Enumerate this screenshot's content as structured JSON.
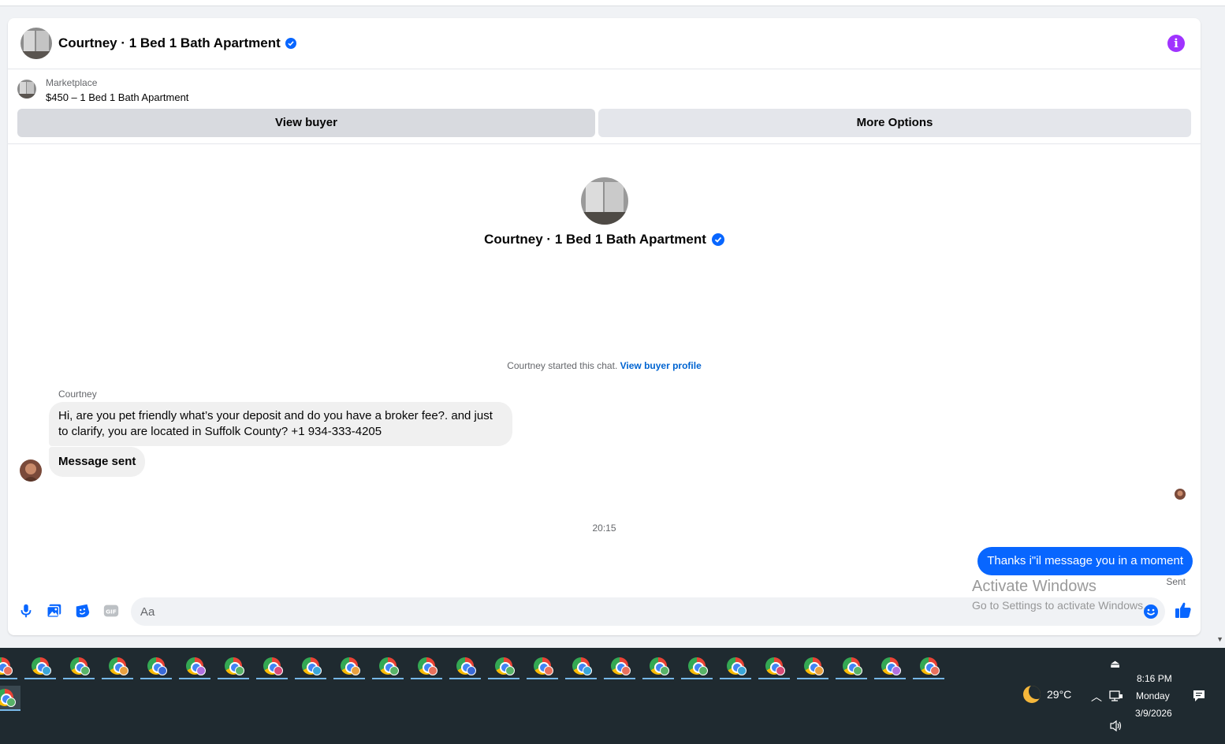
{
  "header": {
    "title": "Courtney · 1 Bed 1 Bath Apartment",
    "info_icon": "info-icon",
    "accent": "#a033ff"
  },
  "marketplace": {
    "label": "Marketplace",
    "listing": "$450 – 1 Bed 1 Bath Apartment",
    "view_buyer": "View buyer",
    "more_options": "More Options"
  },
  "profile": {
    "name": "Courtney · 1 Bed 1 Bath Apartment"
  },
  "chat": {
    "started_text": "Courtney started this chat.",
    "view_profile_link": "View buyer profile",
    "sender_name": "Courtney",
    "incoming": [
      "Hi, are you pet friendly what’s your deposit and do you have a broker fee?. and just to clarify, you are located in Suffolk County? +1 934-333-4205",
      "Message sent"
    ],
    "timestamp": "20:15",
    "outgoing": "Thanks i\"il message you in a moment",
    "status": "Sent",
    "bubble_color": "#0866ff"
  },
  "composer": {
    "placeholder": "Aa",
    "icons": [
      "microphone-icon",
      "photo-icon",
      "sticker-icon",
      "gif-icon",
      "emoji-icon",
      "like-icon"
    ]
  },
  "watermark": {
    "title": "Activate Windows",
    "subtitle": "Go to Settings to activate Windows."
  },
  "taskbar": {
    "app_count": 25,
    "temperature": "29°C",
    "time": "8:16 PM",
    "day": "Monday",
    "date": "3/9/2026",
    "badge_colors": [
      "#e8705c",
      "#3aa6d8",
      "#58b368",
      "#e8a040",
      "#3a6ad8",
      "#b070e0",
      "#58b368",
      "#d84a78",
      "#3aa6d8",
      "#e8a040",
      "#58b368",
      "#e8705c",
      "#3a6ad8",
      "#58b368",
      "#e8705c",
      "#3aa6d8",
      "#e8705c",
      "#58b368",
      "#58b368",
      "#3aa6d8",
      "#d84a78",
      "#e8a040",
      "#58b368",
      "#b070e0",
      "#e8705c",
      "#58b368"
    ]
  }
}
